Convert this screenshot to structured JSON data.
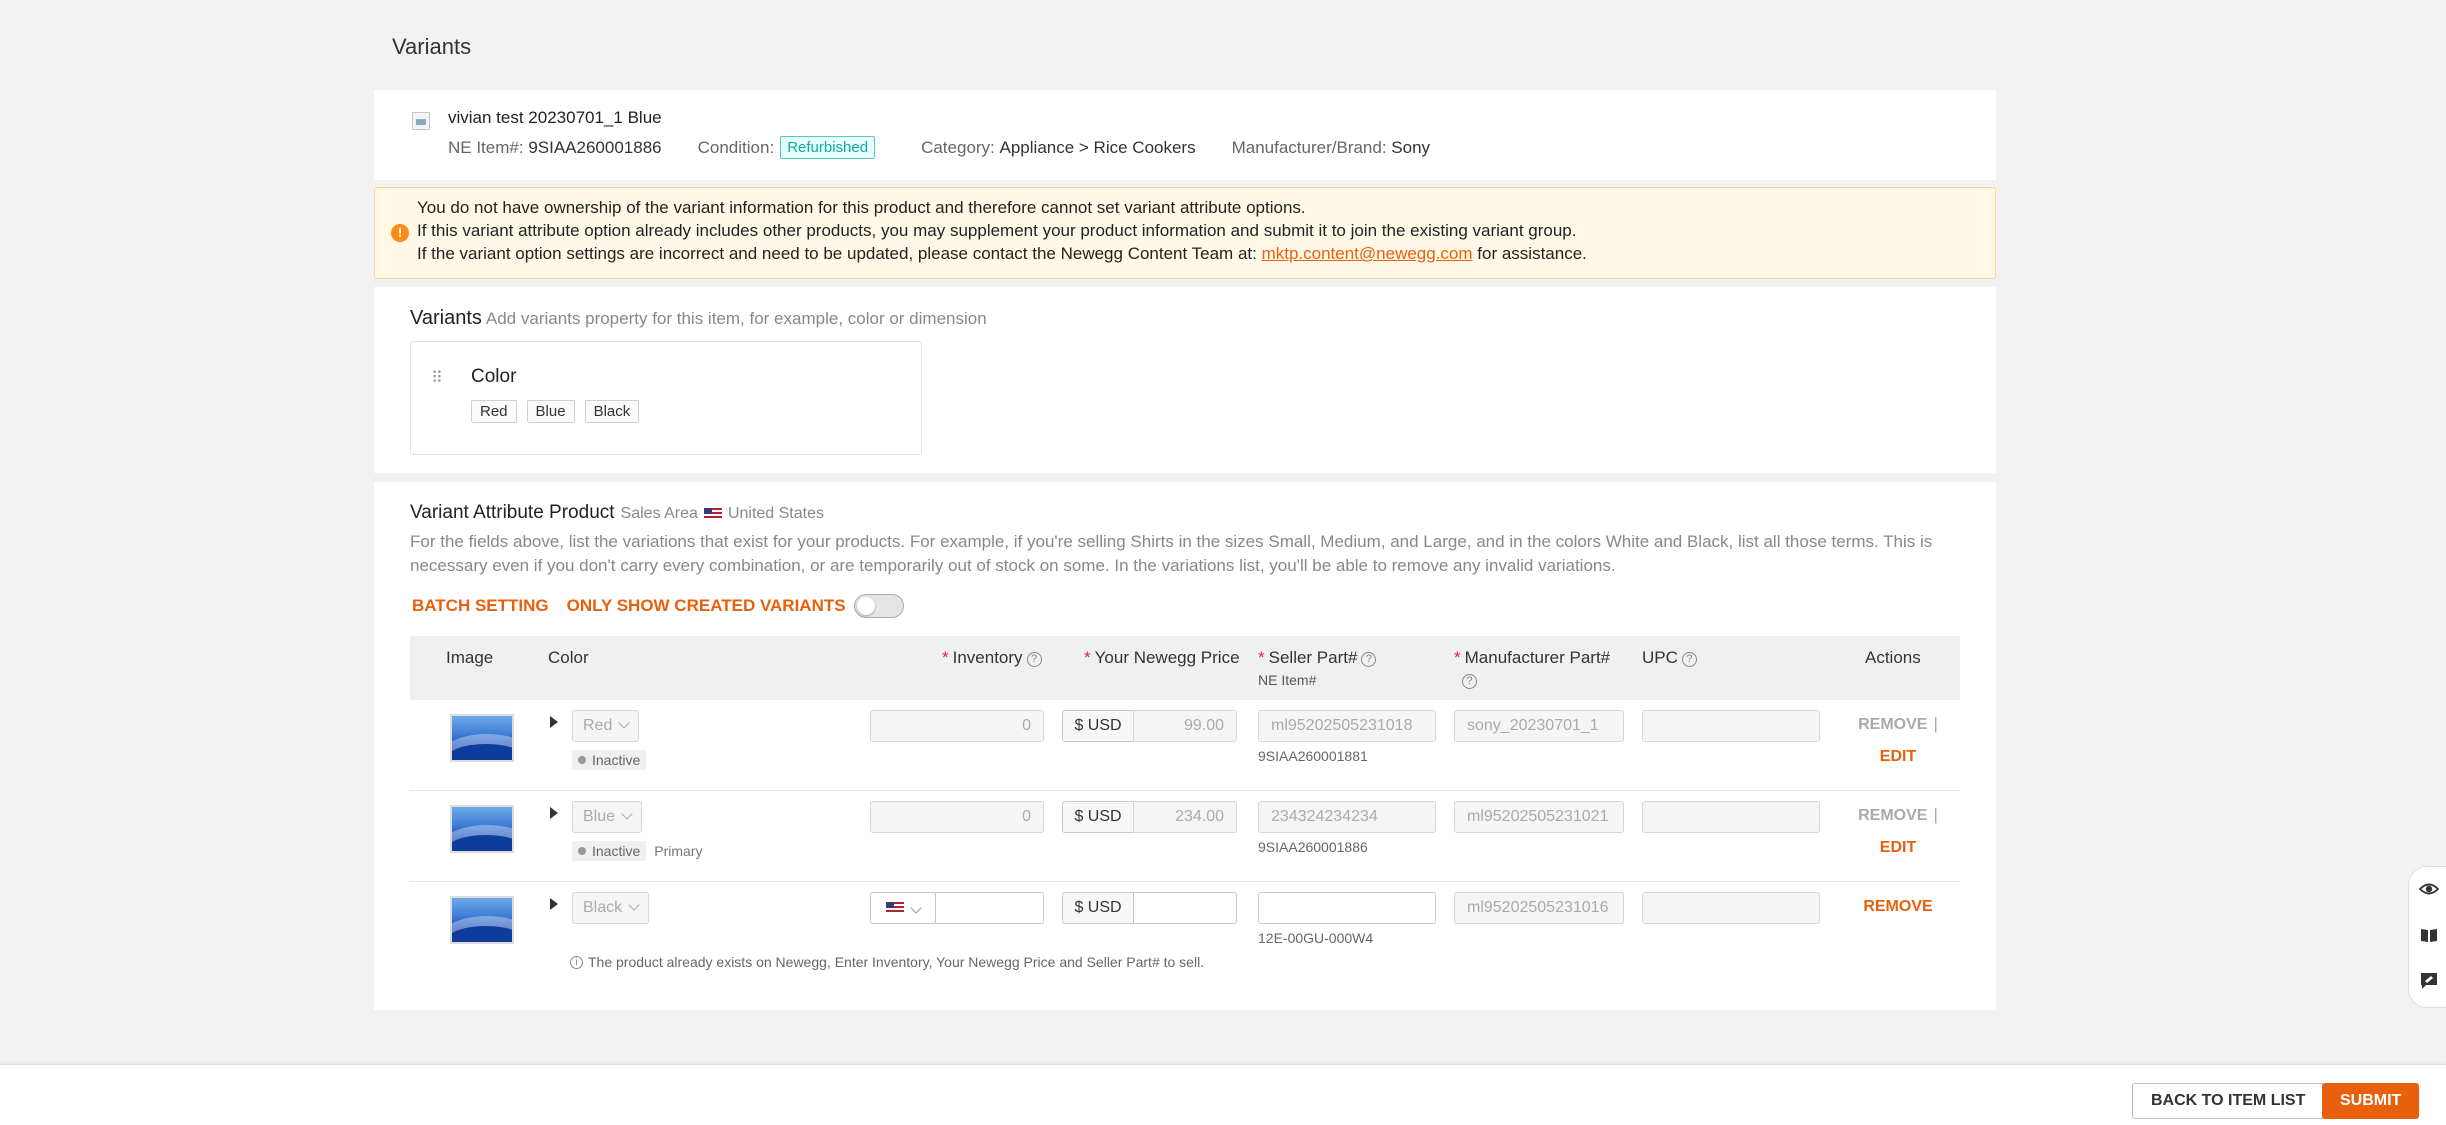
{
  "page": {
    "title": "Variants"
  },
  "product": {
    "name": "vivian test 20230701_1 Blue",
    "item_label": "NE Item#:",
    "item_value": "9SIAA260001886",
    "condition_label": "Condition:",
    "condition_value": "Refurbished",
    "category_label": "Category:",
    "category_value": "Appliance > Rice Cookers",
    "brand_label": "Manufacturer/Brand:",
    "brand_value": "Sony"
  },
  "warning": {
    "line1": "You do not have ownership of the variant information for this product and therefore cannot set variant attribute options.",
    "line2": "If this variant attribute option already includes other products, you may supplement your product information and submit it to join the existing variant group.",
    "line3_pre": "If the variant option settings are incorrect and need to be updated, please contact the Newegg Content Team at: ",
    "line3_link": "mktp.content@newegg.com",
    "line3_post": " for assistance."
  },
  "variants": {
    "title": "Variants",
    "subtitle": "Add variants property for this item, for example, color or dimension",
    "property_name": "Color",
    "tags": [
      "Red",
      "Blue",
      "Black"
    ]
  },
  "attributes": {
    "title": "Variant Attribute Product",
    "sales_area_label": "Sales Area",
    "sales_area_value": "United States",
    "description": "For the fields above, list the variations that exist for your products. For example, if you're selling Shirts in the sizes Small, Medium, and Large, and in the colors White and Black, list all those terms. This is necessary even if you don't carry every combination, or are temporarily out of stock on some. In the variations list, you'll be able to remove any invalid variations.",
    "batch_setting": "BATCH SETTING",
    "only_show_created": "ONLY SHOW CREATED VARIANTS",
    "columns": {
      "image": "Image",
      "color": "Color",
      "inventory": "Inventory",
      "price": "Your Newegg Price",
      "seller_part": "Seller Part#",
      "seller_part_sub": "NE Item#",
      "mfr_part": "Manufacturer Part#",
      "upc": "UPC",
      "actions": "Actions"
    },
    "currency": "$ USD",
    "rows": [
      {
        "color": "Red",
        "status": "Inactive",
        "primary": "",
        "inventory": "0",
        "price": "99.00",
        "seller_part": "ml95202505231018",
        "ne_item": "9SIAA260001881",
        "mfr_part": "sony_20230701_1",
        "upc": "",
        "remove": "REMOVE",
        "sep": "|",
        "edit": "EDIT"
      },
      {
        "color": "Blue",
        "status": "Inactive",
        "primary": "Primary",
        "inventory": "0",
        "price": "234.00",
        "seller_part": "234324234234",
        "ne_item": "9SIAA260001886",
        "mfr_part": "ml95202505231021",
        "upc": "",
        "remove": "REMOVE",
        "sep": "|",
        "edit": "EDIT"
      },
      {
        "color": "Black",
        "inventory": "",
        "price": "",
        "seller_part": "",
        "ne_item": "12E-00GU-000W4",
        "mfr_part": "ml95202505231016",
        "upc": "",
        "remove": "REMOVE",
        "hint": "The product already exists on Newegg, Enter Inventory, Your Newegg Price and Seller Part# to sell."
      }
    ]
  },
  "footer": {
    "back_label": "BACK TO ITEM LIST",
    "submit_label": "SUBMIT"
  },
  "colors": {
    "accent": "#e8600c",
    "warning_bg": "#fff8e6",
    "teal": "#13a8a8"
  }
}
